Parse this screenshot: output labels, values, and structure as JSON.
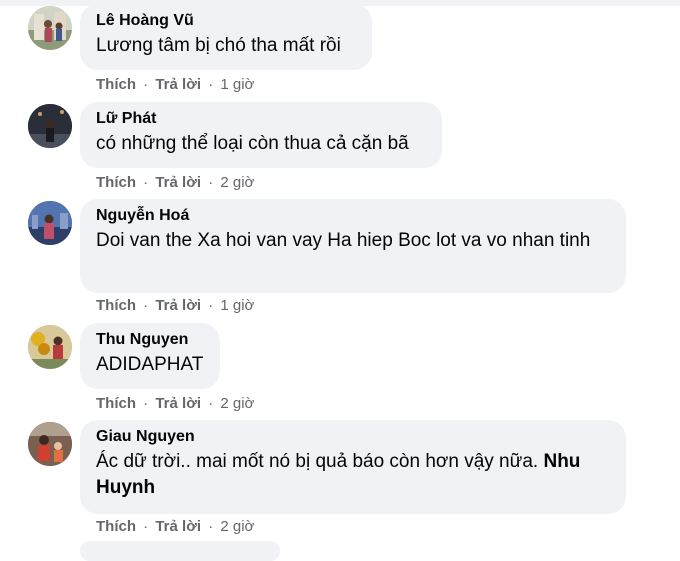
{
  "comments": [
    {
      "author": "Lê Hoàng Vũ",
      "text": "Lương tâm bị chó tha mất rồi",
      "mention": "",
      "like": "Thích",
      "reply": "Trả lời",
      "sep": "·",
      "time": "1 giờ"
    },
    {
      "author": "Lữ Phát",
      "text": "có những thể loại còn thua cả cặn bã",
      "mention": "",
      "like": "Thích",
      "reply": "Trả lời",
      "sep": "·",
      "time": "2 giờ"
    },
    {
      "author": "Nguyễn Hoá",
      "text": "Doi van the Xa hoi van vay Ha hiep Boc lot va vo nhan tinh",
      "mention": "",
      "like": "Thích",
      "reply": "Trả lời",
      "sep": "·",
      "time": "1 giờ"
    },
    {
      "author": "Thu Nguyen",
      "text": "ADIDAPHAT",
      "mention": "",
      "like": "Thích",
      "reply": "Trả lời",
      "sep": "·",
      "time": "2 giờ"
    },
    {
      "author": "Giau Nguyen",
      "text": "Ác dữ trời.. mai mốt nó bị quả báo còn hơn vậy nữa.",
      "mention": "Nhu Huynh",
      "like": "Thích",
      "reply": "Trả lời",
      "sep": "·",
      "time": "2 giờ"
    }
  ]
}
